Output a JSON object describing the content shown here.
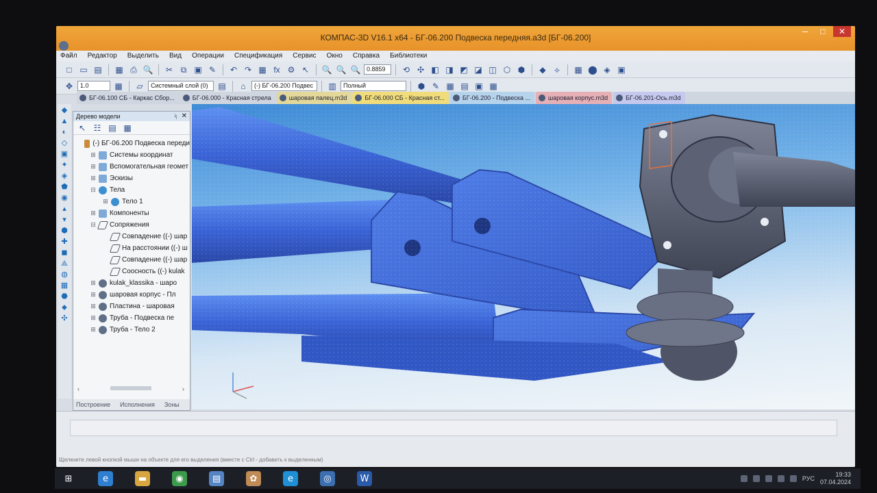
{
  "window": {
    "title": "КОМПАС-3D V16.1 x64 - БГ-06.200  Подвеска передняя.a3d [БГ-06.200]",
    "minimize": "─",
    "maximize": "□",
    "close": "✕"
  },
  "menu": [
    "Файл",
    "Редактор",
    "Выделить",
    "Вид",
    "Операции",
    "Спецификация",
    "Сервис",
    "Окно",
    "Справка",
    "Библиотеки"
  ],
  "toolbar1": {
    "buttons": [
      "□",
      "▭",
      "▤",
      "▦",
      "⎙",
      "🔍",
      "✂",
      "⧉",
      "▣",
      "✎",
      "↶",
      "↷",
      "▦",
      "fx",
      "⚙",
      "↖",
      "🔍",
      "🔍",
      "🔍"
    ],
    "zoom_value": "0.8859",
    "view_buttons": [
      "⟲",
      "✣",
      "◧",
      "◨",
      "◩",
      "◪",
      "◫",
      "⬡",
      "⬢",
      "◆",
      "⟡",
      "▦",
      "⬤",
      "◈",
      "▣"
    ]
  },
  "toolbar2": {
    "step_value": "1.0",
    "layer_value": "Системный слой (0)",
    "doc_value": "(-) БГ-06.200 Подвес",
    "mode_value": "Полный"
  },
  "tabs": [
    {
      "label": "БГ-06.100 СБ - Каркас Сбор...",
      "color": "#cfd6e0"
    },
    {
      "label": "БГ-06.000 - Красная стрела",
      "color": "#cfd6e0"
    },
    {
      "label": "шаровая палец.m3d",
      "color": "#e3d89a"
    },
    {
      "label": "БГ-06.000 СБ - Красная ст...",
      "color": "#f0dc7a"
    },
    {
      "label": "БГ-06.200 - Подвеска ...",
      "color": "#b6d3ec"
    },
    {
      "label": "шаровая корпус.m3d",
      "color": "#e7b0b6"
    },
    {
      "label": "БГ-06.201-Ось.m3d",
      "color": "#c6c9ee"
    }
  ],
  "tree_panel": {
    "title": "Дерево модели",
    "pin": "ᛋ",
    "close": "✕",
    "tools": [
      "↖",
      "☷",
      "▤",
      "▦"
    ],
    "nodes": [
      {
        "label": "(-) БГ-06.200 Подвеска переди",
        "level": 0,
        "expander": "",
        "icon": "folder"
      },
      {
        "label": "Системы координат",
        "level": 1,
        "expander": "⊞",
        "icon": "coord"
      },
      {
        "label": "Вспомогательная геомет",
        "level": 1,
        "expander": "⊞",
        "icon": "coord"
      },
      {
        "label": "Эскизы",
        "level": 1,
        "expander": "⊞",
        "icon": "coord"
      },
      {
        "label": "Тела",
        "level": 1,
        "expander": "⊟",
        "icon": "body"
      },
      {
        "label": "Тело 1",
        "level": 2,
        "expander": "⊞",
        "icon": "body"
      },
      {
        "label": "Компоненты",
        "level": 1,
        "expander": "⊞",
        "icon": "coord"
      },
      {
        "label": "Сопряжения",
        "level": 1,
        "expander": "⊟",
        "icon": "mate"
      },
      {
        "label": "Совпадение ((-) шар",
        "level": 2,
        "expander": "",
        "icon": "mate"
      },
      {
        "label": "На расстоянии ((-) ш",
        "level": 2,
        "expander": "",
        "icon": "mate"
      },
      {
        "label": "Совпадение ((-) шар",
        "level": 2,
        "expander": "",
        "icon": "mate"
      },
      {
        "label": "Соосность ((-) kulak",
        "level": 2,
        "expander": "",
        "icon": "mate"
      },
      {
        "label": "kulak_klassika - шаро",
        "level": 1,
        "expander": "⊞",
        "icon": "part"
      },
      {
        "label": "шаровая корпус - Пл",
        "level": 1,
        "expander": "⊞",
        "icon": "part"
      },
      {
        "label": "Пластина - шаровая",
        "level": 1,
        "expander": "⊞",
        "icon": "part"
      },
      {
        "label": "Труба - Подвеска пе",
        "level": 1,
        "expander": "⊞",
        "icon": "part"
      },
      {
        "label": "Труба - Тело 2",
        "level": 1,
        "expander": "⊞",
        "icon": "part"
      }
    ],
    "scroll_left": "‹",
    "scroll_right": "›",
    "bottom_tabs": [
      "Построение",
      "Исполнения",
      "Зоны"
    ]
  },
  "status_hint": "Щелкните левой кнопкой мыши на объекте для его выделения (вместе с Ctrl - добавить к выделенным)",
  "taskbar": {
    "apps": [
      {
        "name": "windows-logo",
        "glyph": "⊞",
        "color": "#1c1f26"
      },
      {
        "name": "ie",
        "glyph": "e",
        "color": "#2e7fcf"
      },
      {
        "name": "folder",
        "glyph": "▬",
        "color": "#d8a640"
      },
      {
        "name": "chrome",
        "glyph": "◉",
        "color": "#3c9b4a"
      },
      {
        "name": "doc",
        "glyph": "▤",
        "color": "#5584c4"
      },
      {
        "name": "tool",
        "glyph": "✿",
        "color": "#c08b56"
      },
      {
        "name": "edge",
        "glyph": "e",
        "color": "#1f8fd6"
      },
      {
        "name": "kompas",
        "glyph": "◎",
        "color": "#3b6fb0"
      },
      {
        "name": "word",
        "glyph": "W",
        "color": "#2b5aa8"
      }
    ],
    "lang": "РУС",
    "time": "19:33",
    "date": "07.04.2024"
  },
  "colors": {
    "title_bar": "#e7922a",
    "model_blue": "#3f6fe0",
    "model_gray": "#5b6172"
  }
}
